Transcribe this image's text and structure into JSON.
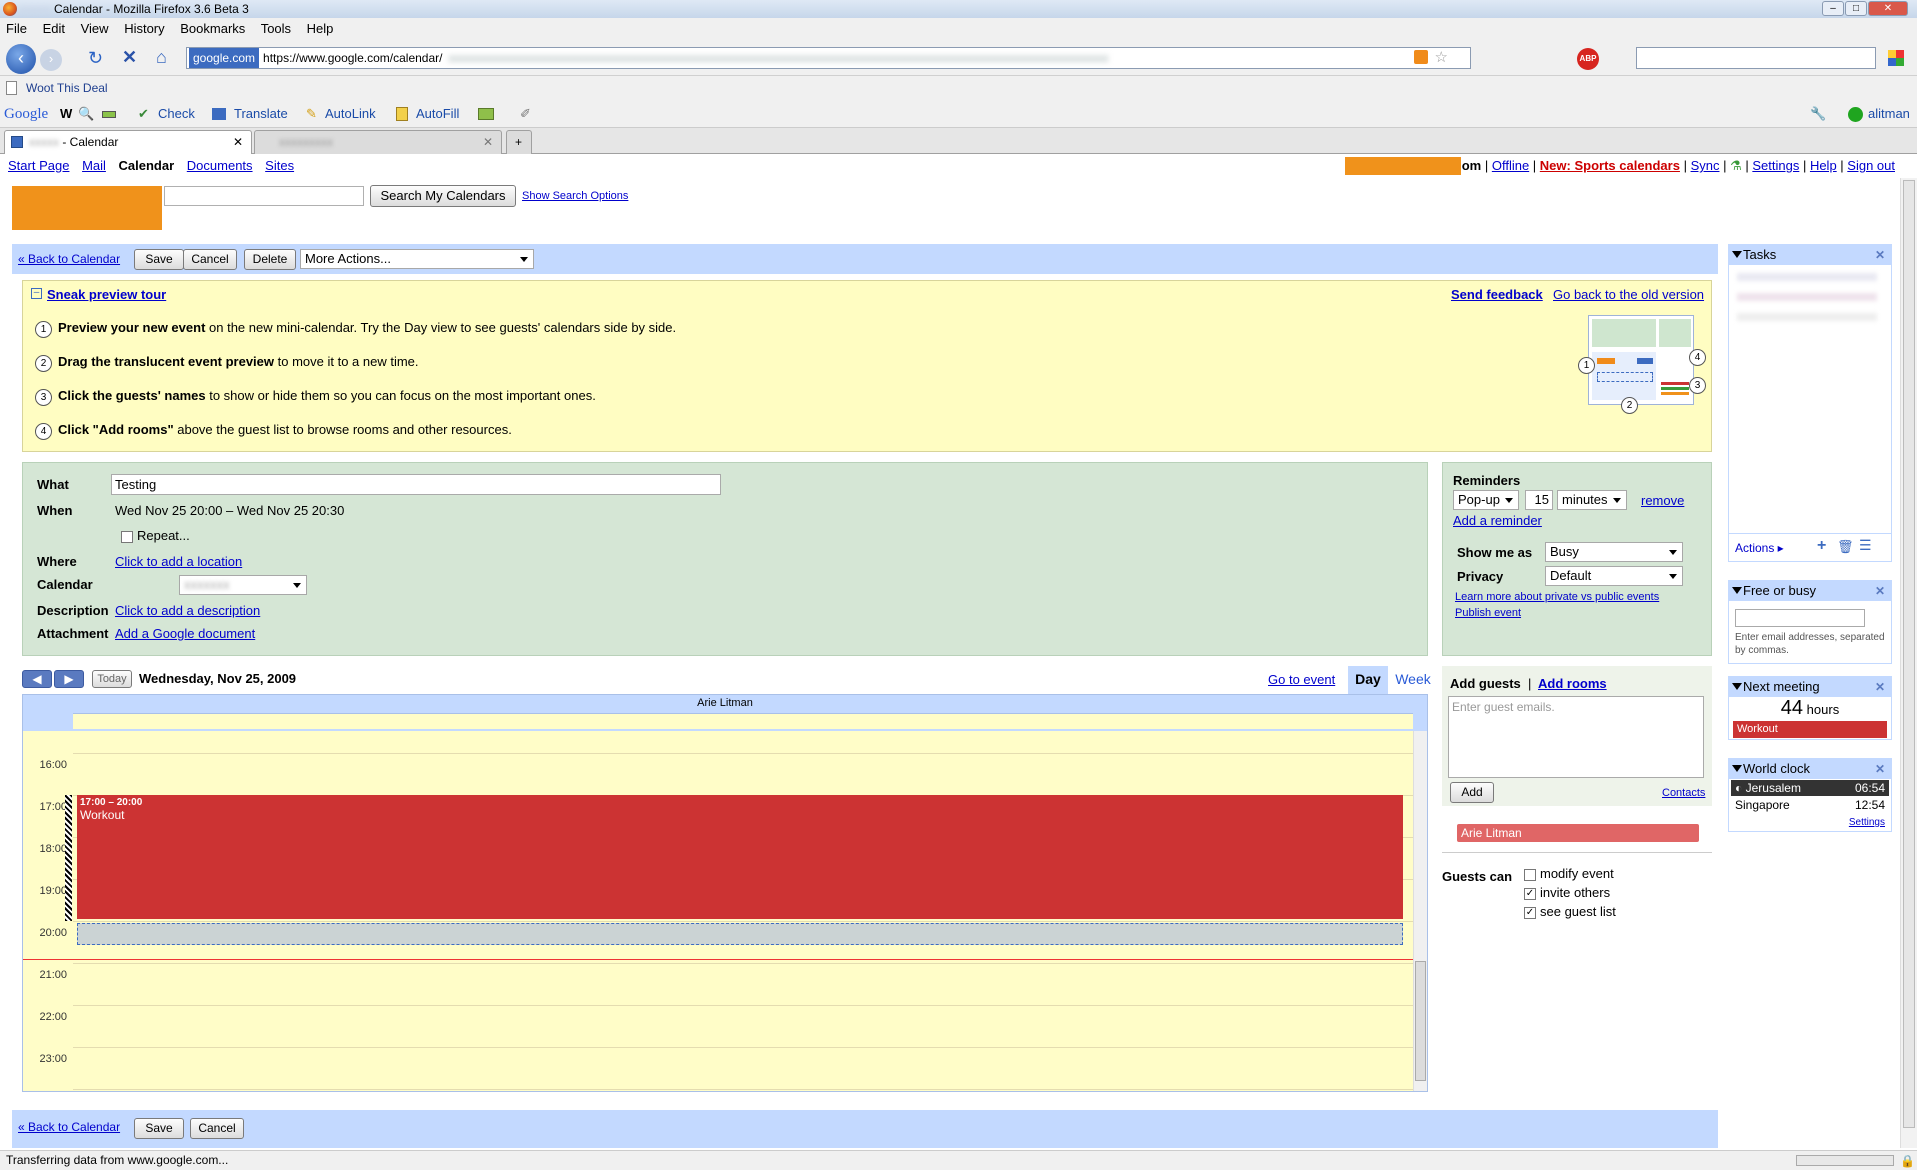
{
  "window": {
    "title": "Calendar - Mozilla Firefox 3.6 Beta 3",
    "title_prefix": "xxxxx"
  },
  "menu": [
    "File",
    "Edit",
    "View",
    "History",
    "Bookmarks",
    "Tools",
    "Help"
  ],
  "nav": {
    "site_label": "google.com",
    "url": "https://www.google.com/calendar/",
    "blurred_url": "xxxxxxxxxxxxxxxxxxxxxxxxxxxxxxxxxxxxxxxxxxxxxxxxxxxxxxxxxxxxxxxxxxxxxxxxxxxxxxxxxxxxxxxxxxxxxxxxxxxxxxxxxxxxxx",
    "abp": "ABP"
  },
  "bookmarks": {
    "item": "Woot This Deal"
  },
  "google_toolbar": {
    "logo": "Google",
    "check": "Check",
    "translate": "Translate",
    "autolink": "AutoLink",
    "autofill": "AutoFill",
    "user": "alitman"
  },
  "tabs": [
    {
      "label": "- Calendar",
      "prefix": "xxxxx"
    },
    {
      "label": "xxxxxxxxx"
    }
  ],
  "gbar": {
    "left": [
      "Start Page",
      "Mail",
      "Calendar",
      "Documents",
      "Sites"
    ],
    "right": {
      "suffix": "om",
      "offline": "Offline",
      "sports": "New: Sports calendars",
      "sync": "Sync",
      "settings": "Settings",
      "help": "Help",
      "signout": "Sign out"
    }
  },
  "search": {
    "button": "Search My Calendars",
    "options": "Show Search Options",
    "value": ""
  },
  "actions": {
    "back": "« Back to Calendar",
    "save": "Save",
    "cancel": "Cancel",
    "delete": "Delete",
    "more": "More Actions..."
  },
  "tour": {
    "title": "Sneak preview tour",
    "feedback": "Send feedback",
    "old_version": "Go back to the old version",
    "steps": [
      {
        "n": "1",
        "bold": "Preview your new event",
        "rest": " on the new mini-calendar. Try the Day view to see guests' calendars side by side."
      },
      {
        "n": "2",
        "bold": "Drag the translucent event preview",
        "rest": " to move it to a new time."
      },
      {
        "n": "3",
        "bold": "Click the guests' names",
        "rest": " to show or hide them so you can focus on the most important ones."
      },
      {
        "n": "4",
        "bold": "Click \"Add rooms\"",
        "rest": " above the guest list to browse rooms and other resources."
      }
    ],
    "illus_nums": [
      "1",
      "2",
      "3",
      "4"
    ]
  },
  "event": {
    "what_label": "What",
    "what_value": "Testing",
    "when_label": "When",
    "when_value": "Wed Nov 25 20:00 – Wed Nov 25 20:30",
    "repeat": "Repeat...",
    "where_label": "Where",
    "where_link": "Click to add a location",
    "calendar_label": "Calendar",
    "calendar_value": "xxxxxxx",
    "description_label": "Description",
    "description_link": "Click to add a description",
    "attachment_label": "Attachment",
    "attachment_link": "Add a Google document"
  },
  "reminders": {
    "title": "Reminders",
    "type": "Pop-up",
    "amount": "15",
    "unit": "minutes",
    "remove": "remove",
    "add": "Add a reminder",
    "show_me_as_label": "Show me as",
    "show_me_as": "Busy",
    "privacy_label": "Privacy",
    "privacy": "Default",
    "learn_more": "Learn more about private vs public events",
    "publish": "Publish event"
  },
  "day_view": {
    "today": "Today",
    "date": "Wednesday, Nov 25, 2009",
    "go_to_event": "Go to event",
    "day": "Day",
    "week": "Week",
    "person": "Arie Litman",
    "hours": [
      "16:00",
      "17:00",
      "18:00",
      "19:00",
      "20:00",
      "21:00",
      "22:00",
      "23:00"
    ],
    "event_time": "17:00 – 20:00",
    "event_title": "Workout"
  },
  "guests": {
    "add_guests": "Add guests",
    "add_rooms": "Add rooms",
    "placeholder": "Enter guest emails.",
    "add": "Add",
    "contacts": "Contacts",
    "guest": "Arie Litman",
    "guests_can": "Guests can",
    "options": [
      {
        "label": "modify event",
        "checked": false
      },
      {
        "label": "invite others",
        "checked": true
      },
      {
        "label": "see guest list",
        "checked": true
      }
    ]
  },
  "gadgets": {
    "tasks": {
      "title": "Tasks",
      "actions": "Actions ▸"
    },
    "free_busy": {
      "title": "Free or busy",
      "hint": "Enter email addresses, separated by commas."
    },
    "next_meeting": {
      "title": "Next meeting",
      "count": "44",
      "unit": "hours",
      "event": "Workout"
    },
    "world_clock": {
      "title": "World clock",
      "rows": [
        {
          "city": "Jerusalem",
          "time": "06:54"
        },
        {
          "city": "Singapore",
          "time": "12:54"
        }
      ],
      "settings": "Settings"
    }
  },
  "status": "Transferring data from www.google.com...",
  "colors": {
    "event_red": "#cc3333",
    "tour_yellow": "#fffdc2",
    "details_green": "#d5e6d5",
    "bar_blue": "#c3d9ff",
    "logo_orange": "#f0921b"
  }
}
